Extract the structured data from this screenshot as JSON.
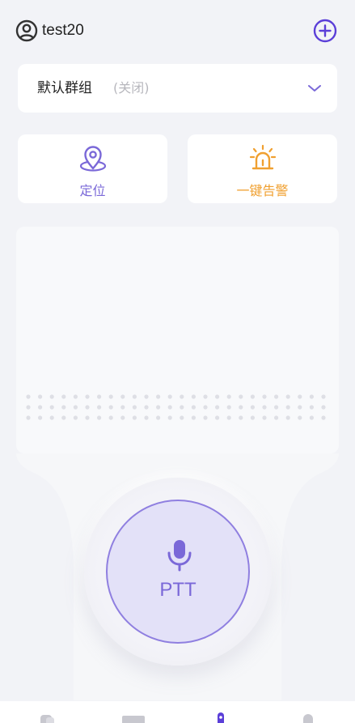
{
  "header": {
    "username": "test20",
    "user_icon": "user-circle-icon",
    "add_icon": "plus-circle-icon"
  },
  "group": {
    "name": "默认群组",
    "status": "(关闭)",
    "dropdown_icon": "chevron-down-icon"
  },
  "actions": {
    "locate": {
      "label": "定位",
      "icon": "location-pin-icon"
    },
    "alarm": {
      "label": "一键告警",
      "icon": "alarm-light-icon"
    }
  },
  "ptt": {
    "label": "PTT",
    "icon": "microphone-icon"
  },
  "nav": {
    "items": [
      {
        "icon": "contacts-icon"
      },
      {
        "icon": "messages-icon"
      },
      {
        "icon": "talk-icon"
      },
      {
        "icon": "profile-icon"
      }
    ]
  },
  "colors": {
    "accent": "#7a68d8",
    "alarm": "#f0a030",
    "background": "#f2f3f7"
  }
}
